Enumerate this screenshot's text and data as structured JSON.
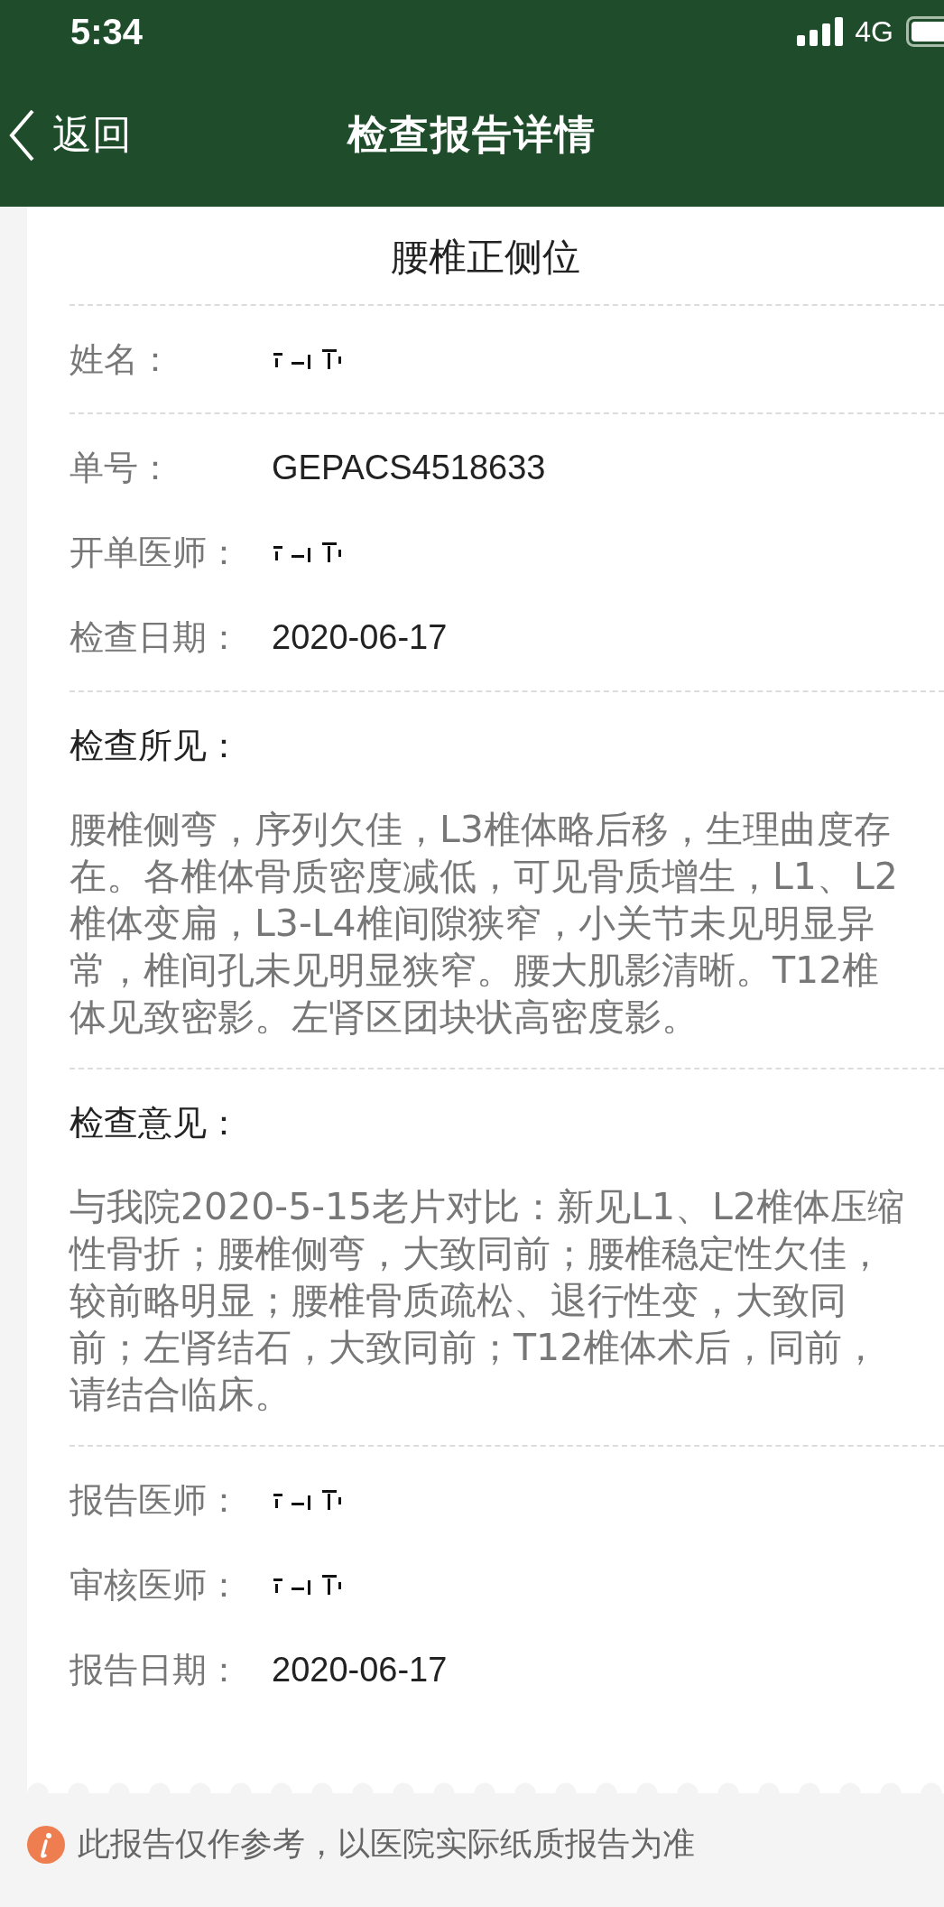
{
  "status_bar": {
    "time": "5:34",
    "network": "4G"
  },
  "nav_bar": {
    "back_label": "返回",
    "title": "检查报告详情"
  },
  "report": {
    "exam_name": "腰椎正侧位",
    "sections": [
      {
        "kind": "fields",
        "fields": [
          {
            "label": "姓名：",
            "redacted": true
          }
        ]
      },
      {
        "kind": "fields",
        "fields": [
          {
            "label": "单号：",
            "value": "GEPACS4518633",
            "redacted": false
          },
          {
            "label": "开单医师：",
            "redacted": true
          },
          {
            "label": "检查日期：",
            "value": "2020-06-17",
            "redacted": false
          }
        ]
      },
      {
        "kind": "text",
        "heading": "检查所见：",
        "text": "腰椎侧弯，序列欠佳，L3椎体略后移，生理曲度存在。各椎体骨质密度减低，可见骨质增生，L1、L2椎体变扁，L3-L4椎间隙狭窄，小关节未见明显异常，椎间孔未见明显狭窄。腰大肌影清晰。T12椎体见致密影。左肾区团块状高密度影。"
      },
      {
        "kind": "text",
        "heading": "检查意见：",
        "text": "与我院2020-5-15老片对比：新见L1、L2椎体压缩性骨折；腰椎侧弯，大致同前；腰椎稳定性欠佳，较前略明显；腰椎骨质疏松、退行性变，大致同前；左肾结石，大致同前；T12椎体术后，同前，请结合临床。"
      },
      {
        "kind": "fields",
        "fields": [
          {
            "label": "报告医师：",
            "redacted": true
          },
          {
            "label": "审核医师：",
            "redacted": true
          },
          {
            "label": "报告日期：",
            "value": "2020-06-17",
            "redacted": false
          }
        ]
      }
    ]
  },
  "notice": "此报告仅作参考，以医院实际纸质报告为准"
}
